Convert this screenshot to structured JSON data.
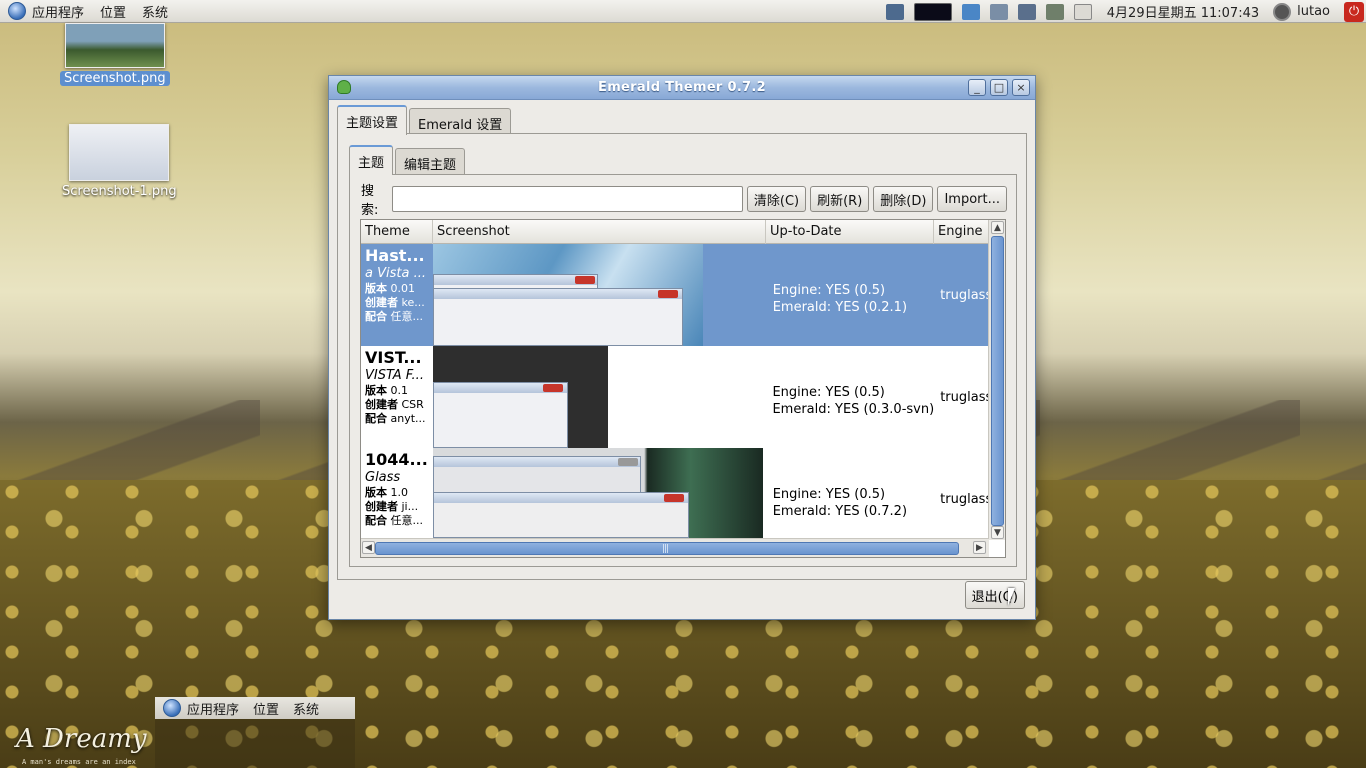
{
  "top_panel": {
    "menus": [
      "应用程序",
      "位置",
      "系统"
    ],
    "clock": "4月29日星期五 11:07:43",
    "user": "lutao"
  },
  "desktop": {
    "icons": [
      {
        "label": "Screenshot.png",
        "selected": true
      },
      {
        "label": "Screenshot-1.png",
        "selected": false
      }
    ]
  },
  "window": {
    "title": "Emerald Themer 0.7.2",
    "controls": {
      "minimize": "_",
      "maximize": "□",
      "close": "×"
    },
    "tabs": [
      "主题设置",
      "Emerald 设置"
    ],
    "subtabs": [
      "主题",
      "编辑主题"
    ],
    "search": {
      "label": "搜索:",
      "value": "",
      "placeholder": ""
    },
    "buttons": {
      "clear": "清除(C)",
      "refresh": "刷新(R)",
      "delete": "删除(D)",
      "import": "Import..."
    },
    "columns": [
      "Theme",
      "Screenshot",
      "Up-to-Date",
      "Engine"
    ],
    "rows": [
      {
        "name": "Hast...",
        "desc": "a Vista ...",
        "version_label": "版本",
        "version": "0.01",
        "author_label": "创建者",
        "author": "ke...",
        "fit_label": "配合",
        "fit": "任意...",
        "engine_status": "Engine: YES (0.5)",
        "emerald_status": "Emerald: YES (0.2.1)",
        "engine": "truglass",
        "selected": true
      },
      {
        "name": "VIST...",
        "desc": "VISTA F...",
        "version_label": "版本",
        "version": "0.1",
        "author_label": "创建者",
        "author": "CSR",
        "fit_label": "配合",
        "fit": "anyt...",
        "engine_status": "Engine: YES (0.5)",
        "emerald_status": "Emerald: YES (0.3.0-svn)",
        "engine": "truglass",
        "selected": false
      },
      {
        "name": "1044...",
        "desc": "Glass",
        "version_label": "版本",
        "version": "1.0",
        "author_label": "创建者",
        "author": "ji...",
        "fit_label": "配合",
        "fit": "任意...",
        "engine_status": "Engine: YES (0.5)",
        "emerald_status": "Emerald: YES (0.7.2)",
        "engine": "truglass",
        "selected": false
      }
    ],
    "quit_label": "退出(Q)"
  },
  "bottom_panel": {
    "menus": [
      "应用程序",
      "位置",
      "系统"
    ]
  },
  "wallpaper": {
    "text": "A Dreamy",
    "subtext": "A man's dreams are an index"
  },
  "colors": {
    "selection": "#6f97cc",
    "titlebar": "#9cb8de",
    "panel": "#e6e4de"
  }
}
